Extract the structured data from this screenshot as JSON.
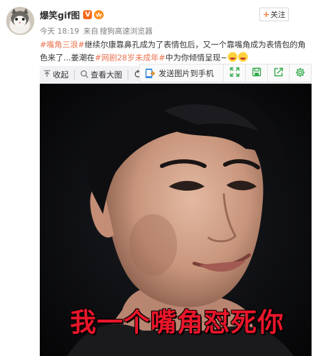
{
  "post": {
    "username": "爆笑gif图",
    "verified_badge": "V",
    "vip_badge": "vip",
    "follow_label": "关注",
    "time": "今天 18:19",
    "source_prefix": "来自",
    "source": "搜狗高速浏览器",
    "text_parts": [
      {
        "type": "hashtag",
        "text": "#嘴角三浪#"
      },
      {
        "type": "text",
        "text": "继续尔康靠鼻孔成为了表情包后，又一个靠嘴角成为表情包的角色来了...姜潮在"
      },
      {
        "type": "hashtag",
        "text": "#网剧28岁未成年#"
      },
      {
        "type": "text",
        "text": "中为你倾情呈现~"
      }
    ]
  },
  "toolbar": {
    "collapse_label": "收起",
    "view_large_label": "查看大图",
    "rotate_icon": "rotate-icon"
  },
  "share_panel": {
    "send_to_phone_label": "发送图片到手机",
    "icons": [
      "expand-icon",
      "save-icon",
      "share-icon",
      "settings-icon"
    ]
  },
  "media": {
    "caption": "我一个嘴角怼死你"
  },
  "colors": {
    "hashtag": "#eb7350",
    "accent": "#fa7d3c",
    "caption": "#e8162a",
    "icon_green": "#2faa4a"
  }
}
